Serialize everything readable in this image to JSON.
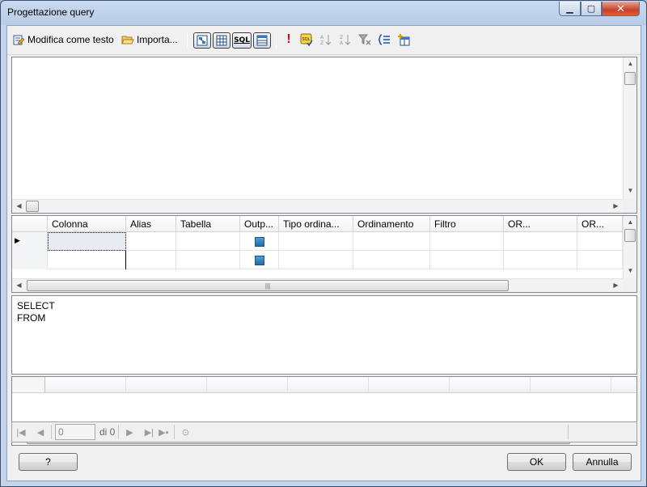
{
  "window": {
    "title": "Progettazione query"
  },
  "toolbar": {
    "edit_as_text": "Modifica come testo",
    "import": "Importa..."
  },
  "grid": {
    "columns": [
      "",
      "Colonna",
      "Alias",
      "Tabella",
      "Outp...",
      "Tipo ordina...",
      "Ordinamento",
      "Filtro",
      "OR...",
      "OR..."
    ]
  },
  "sql": {
    "text": "SELECT\nFROM"
  },
  "nav": {
    "record_value": "0",
    "of_label": "di 0"
  },
  "buttons": {
    "help": "?",
    "ok": "OK",
    "cancel": "Annulla"
  }
}
